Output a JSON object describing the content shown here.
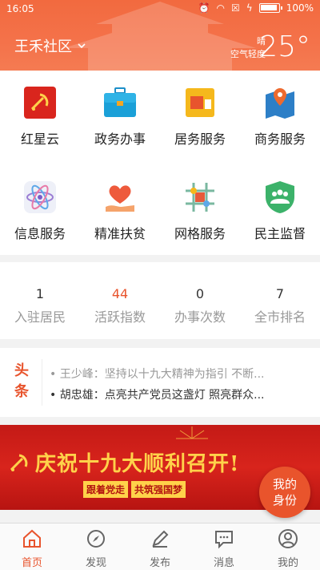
{
  "status_bar": {
    "time": "16:05",
    "battery": "100%"
  },
  "header": {
    "community": "王禾社区",
    "weather": "晴",
    "air_quality": "空气轻度",
    "temperature": "25°"
  },
  "services": [
    {
      "label": "红星云",
      "icon": "party-flag-icon"
    },
    {
      "label": "政务办事",
      "icon": "briefcase-icon"
    },
    {
      "label": "居务服务",
      "icon": "folder-icon"
    },
    {
      "label": "商务服务",
      "icon": "map-pin-icon"
    },
    {
      "label": "信息服务",
      "icon": "atom-icon"
    },
    {
      "label": "精准扶贫",
      "icon": "heart-hand-icon"
    },
    {
      "label": "网格服务",
      "icon": "grid-network-icon"
    },
    {
      "label": "民主监督",
      "icon": "shield-people-icon"
    }
  ],
  "stats": [
    {
      "value": "1",
      "label": "入驻居民"
    },
    {
      "value": "44",
      "label": "活跃指数"
    },
    {
      "value": "0",
      "label": "办事次数"
    },
    {
      "value": "7",
      "label": "全市排名"
    }
  ],
  "headlines": {
    "tag_line1": "头",
    "tag_line2": "条",
    "items": [
      "• 王少峰：坚持以十九大精神为指引 不断...",
      "• 胡忠雄：点亮共产党员这盏灯 照亮群众..."
    ]
  },
  "banner": {
    "title": "庆祝十九大顺利召开!",
    "subtitle": [
      "跟着党走",
      "共筑强国梦"
    ]
  },
  "floating_badge": {
    "line1": "我的",
    "line2": "身份"
  },
  "tabs": [
    {
      "label": "首页",
      "icon": "home-icon"
    },
    {
      "label": "发现",
      "icon": "compass-icon"
    },
    {
      "label": "发布",
      "icon": "pen-icon"
    },
    {
      "label": "消息",
      "icon": "message-icon"
    },
    {
      "label": "我的",
      "icon": "user-icon"
    }
  ],
  "colors": {
    "accent": "#e8542d",
    "header": "#f26a3f",
    "banner": "#c41a16",
    "gold": "#ffd24a"
  }
}
